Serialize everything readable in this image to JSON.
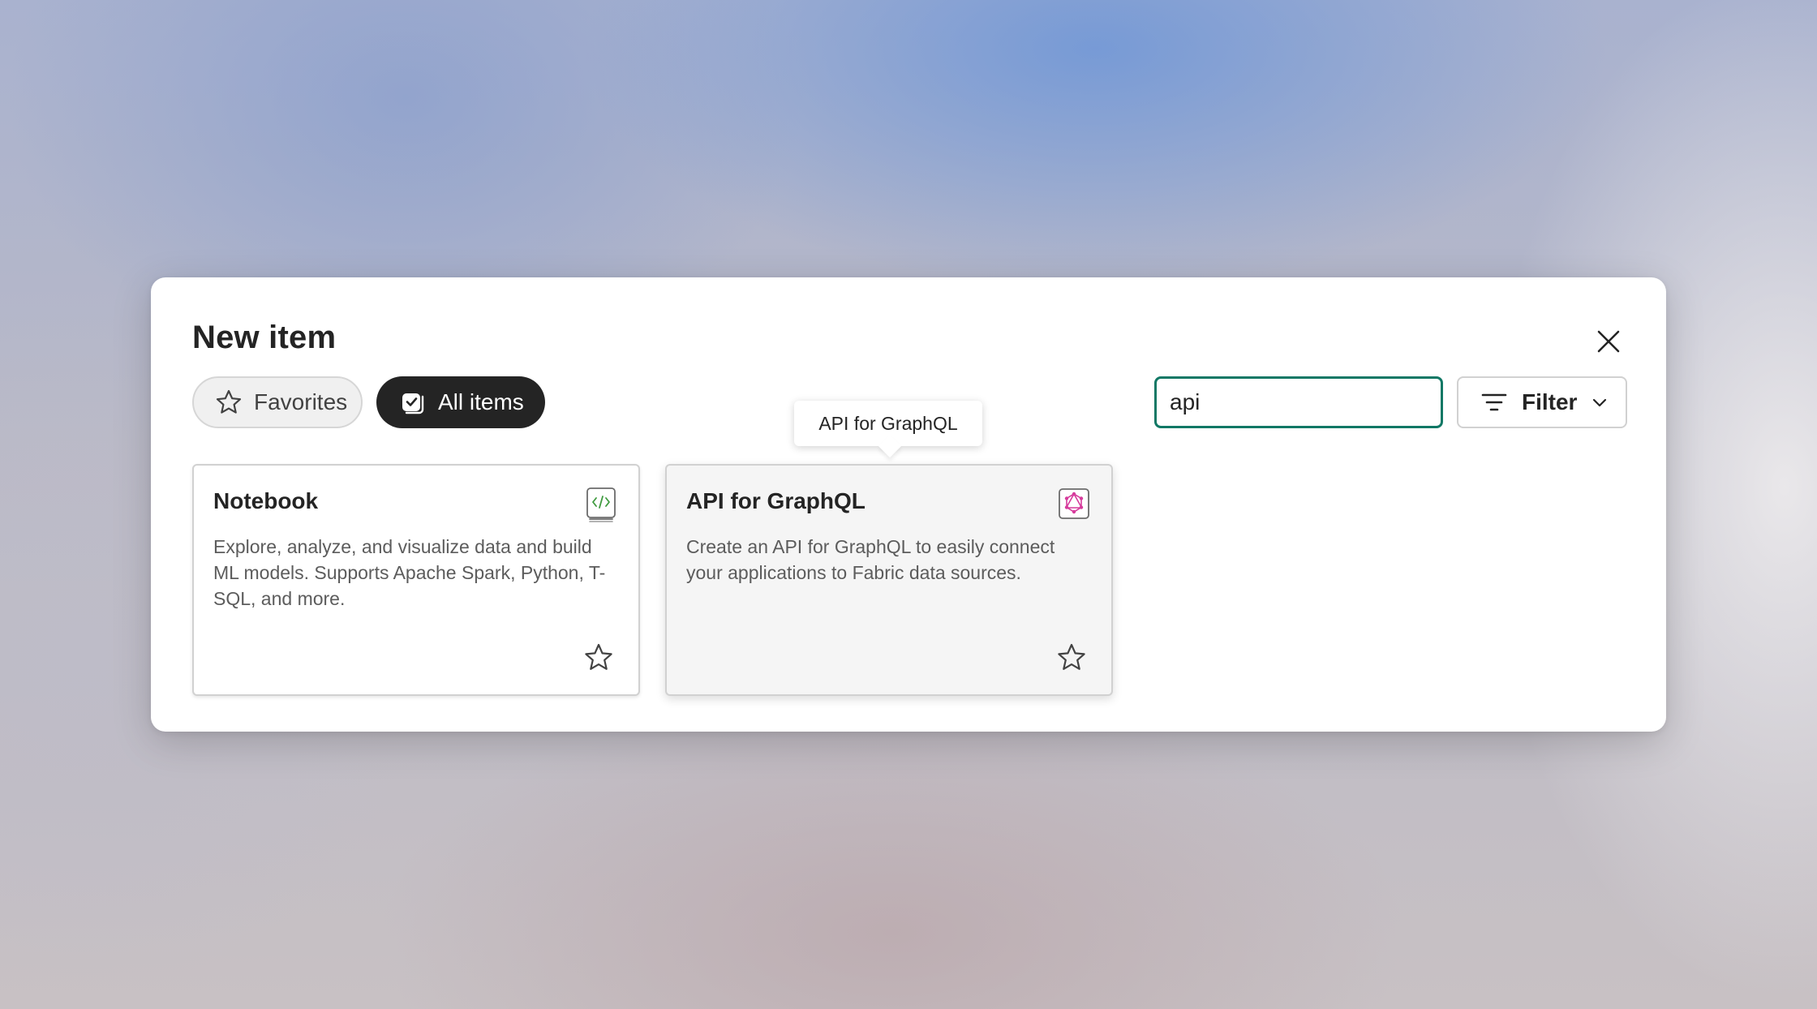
{
  "dialog": {
    "title": "New item",
    "close_icon": "close-icon"
  },
  "tabs": [
    {
      "label": "Favorites",
      "icon": "star-outline-icon",
      "selected": false
    },
    {
      "label": "All items",
      "icon": "checkbox-stack-icon",
      "selected": true
    }
  ],
  "search": {
    "value": "api",
    "clear_icon": "dismiss-icon",
    "accent_color": "#117865"
  },
  "filter": {
    "label": "Filter",
    "icon": "filter-lines-icon",
    "chevron": "chevron-down-icon"
  },
  "tooltip": {
    "text": "API for GraphQL"
  },
  "cards": [
    {
      "title": "Notebook",
      "description": "Explore, analyze, and visualize data and build ML models. Supports Apache Spark, Python, T-SQL, and more.",
      "icon": "notebook-icon",
      "favorite_icon": "star-outline-icon"
    },
    {
      "title": "API for GraphQL",
      "description": "Create an API for GraphQL to easily connect your applications to Fabric data sources.",
      "icon": "graphql-icon",
      "favorite_icon": "star-outline-icon"
    }
  ]
}
